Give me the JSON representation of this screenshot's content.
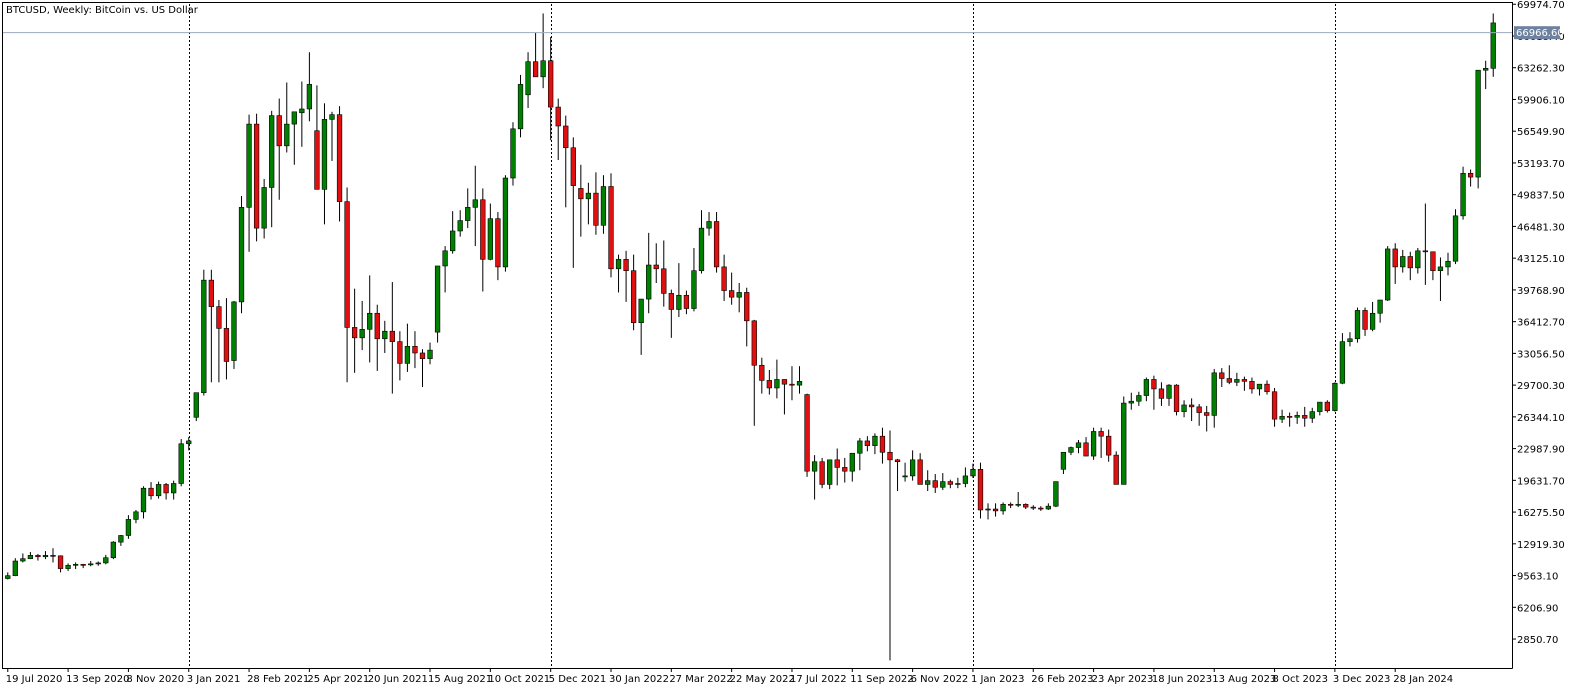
{
  "chart_data": {
    "type": "candlestick",
    "title": "BTCUSD, Weekly:  BitCoin vs. US Dollar",
    "ylim": [
      0,
      70000
    ],
    "y_ticks": [
      "69974.70",
      "66618.40",
      "63262.30",
      "59906.10",
      "56549.90",
      "53193.70",
      "49837.50",
      "46481.30",
      "43125.10",
      "39768.90",
      "36412.70",
      "33056.50",
      "29700.30",
      "26344.10",
      "22987.90",
      "19631.70",
      "16275.50",
      "12919.30",
      "9563.10",
      "6206.90",
      "2850.70"
    ],
    "x_labels": [
      "19 Jul 2020",
      "13 Sep 2020",
      "8 Nov 2020",
      "3 Jan 2021",
      "28 Feb 2021",
      "25 Apr 2021",
      "20 Jun 2021",
      "15 Aug 2021",
      "10 Oct 2021",
      "5 Dec 2021",
      "30 Jan 2022",
      "27 Mar 2022",
      "22 May 2022",
      "17 Jul 2022",
      "11 Sep 2022",
      "6 Nov 2022",
      "1 Jan 2023",
      "26 Feb 2023",
      "23 Apr 2023",
      "18 Jun 2023",
      "13 Aug 2023",
      "8 Oct 2023",
      "3 Dec 2023",
      "28 Jan 2024"
    ],
    "current_price": "66966.60",
    "year_separators": [
      "3 Jan 2021",
      "5 Dec 2021",
      "1 Jan 2023",
      "3 Dec 2023"
    ],
    "colors": {
      "bull": "#008000",
      "bear": "#e01010",
      "wick": "#000000",
      "grid": "#000000",
      "price_line": "#9aaabb",
      "price_tag": "#6e82a0"
    },
    "candles": [
      [
        9250,
        9900,
        9150,
        9550
      ],
      [
        9550,
        11400,
        9500,
        11100
      ],
      [
        11100,
        11900,
        10950,
        11350
      ],
      [
        11350,
        12050,
        11300,
        11700
      ],
      [
        11700,
        11850,
        11150,
        11550
      ],
      [
        11550,
        12150,
        11300,
        11700
      ],
      [
        11700,
        12450,
        10950,
        11650
      ],
      [
        11650,
        11700,
        9900,
        10300
      ],
      [
        10300,
        10850,
        10050,
        10650
      ],
      [
        10650,
        10950,
        10250,
        10750
      ],
      [
        10750,
        10800,
        10350,
        10700
      ],
      [
        10700,
        11100,
        10550,
        10800
      ],
      [
        10800,
        11050,
        10600,
        10900
      ],
      [
        10900,
        11750,
        10750,
        11450
      ],
      [
        11450,
        13200,
        11300,
        13100
      ],
      [
        13100,
        13850,
        12700,
        13800
      ],
      [
        13800,
        15950,
        13450,
        15500
      ],
      [
        15500,
        16500,
        15100,
        16300
      ],
      [
        16300,
        19000,
        15600,
        18800
      ],
      [
        18800,
        19450,
        17600,
        18000
      ],
      [
        18000,
        19500,
        17700,
        19200
      ],
      [
        19200,
        19350,
        17600,
        18300
      ],
      [
        18300,
        19600,
        17600,
        19300
      ],
      [
        19300,
        24000,
        19000,
        23500
      ],
      [
        23500,
        24200,
        22800,
        23800
      ],
      [
        26300,
        28900,
        25900,
        28900
      ],
      [
        28900,
        41900,
        28600,
        40800
      ],
      [
        40800,
        41900,
        30000,
        38000
      ],
      [
        38000,
        38700,
        30000,
        35700
      ],
      [
        35700,
        38900,
        30300,
        32200
      ],
      [
        32300,
        38600,
        31400,
        38500
      ],
      [
        38500,
        49700,
        37300,
        48500
      ],
      [
        48500,
        58300,
        43800,
        57300
      ],
      [
        57300,
        58400,
        44900,
        46300
      ],
      [
        46300,
        51500,
        45200,
        50600
      ],
      [
        50600,
        58700,
        46400,
        58200
      ],
      [
        58200,
        60000,
        49300,
        55000
      ],
      [
        55000,
        61700,
        54300,
        57300
      ],
      [
        57300,
        57500,
        53000,
        58600
      ],
      [
        58500,
        61800,
        54900,
        58900
      ],
      [
        58900,
        64900,
        57600,
        61500
      ],
      [
        56600,
        61400,
        50500,
        50400
      ],
      [
        50400,
        59500,
        46700,
        57800
      ],
      [
        57800,
        58600,
        53400,
        58300
      ],
      [
        58300,
        59200,
        47000,
        49100
      ],
      [
        49100,
        50600,
        30000,
        35800
      ],
      [
        35800,
        39900,
        31000,
        34700
      ],
      [
        34700,
        38600,
        33400,
        35600
      ],
      [
        35600,
        41300,
        32100,
        37300
      ],
      [
        37300,
        38200,
        31200,
        34600
      ],
      [
        34600,
        36500,
        33100,
        35400
      ],
      [
        35400,
        40600,
        28800,
        34300
      ],
      [
        34300,
        35400,
        30200,
        32000
      ],
      [
        32000,
        36200,
        31100,
        33800
      ],
      [
        33800,
        35400,
        31500,
        33100
      ],
      [
        33100,
        33500,
        29500,
        32500
      ],
      [
        32500,
        34200,
        31900,
        33400
      ],
      [
        35300,
        42200,
        34200,
        42300
      ],
      [
        42300,
        44400,
        39500,
        43900
      ],
      [
        43900,
        48100,
        43600,
        46000
      ],
      [
        46000,
        48200,
        45400,
        47100
      ],
      [
        47100,
        50500,
        46300,
        48500
      ],
      [
        48500,
        52900,
        44400,
        49300
      ],
      [
        49300,
        50500,
        39600,
        43000
      ],
      [
        43000,
        48900,
        42900,
        47300
      ],
      [
        47300,
        48000,
        40800,
        42200
      ],
      [
        42200,
        51900,
        41700,
        51600
      ],
      [
        51600,
        57500,
        50800,
        56800
      ],
      [
        56800,
        62500,
        55900,
        61500
      ],
      [
        60400,
        64900,
        59000,
        63900
      ],
      [
        63900,
        67000,
        62500,
        62300
      ],
      [
        62300,
        69000,
        61100,
        64000
      ],
      [
        64000,
        66500,
        55600,
        59100
      ],
      [
        59100,
        60000,
        53500,
        57100
      ],
      [
        57100,
        58200,
        48500,
        54800
      ],
      [
        54800,
        55900,
        42100,
        50800
      ],
      [
        50500,
        53000,
        45400,
        49400
      ],
      [
        49400,
        51100,
        46700,
        50000
      ],
      [
        50000,
        52200,
        45600,
        46600
      ],
      [
        46600,
        51900,
        45700,
        50700
      ],
      [
        50700,
        52100,
        41100,
        42000
      ],
      [
        42000,
        43500,
        39500,
        43000
      ],
      [
        43000,
        43900,
        38500,
        41800
      ],
      [
        41800,
        43500,
        35500,
        36300
      ],
      [
        36300,
        38500,
        32900,
        38800
      ],
      [
        38800,
        45800,
        37300,
        42400
      ],
      [
        42400,
        44700,
        40500,
        42000
      ],
      [
        42000,
        45000,
        38000,
        39400
      ],
      [
        39400,
        39800,
        34700,
        37700
      ],
      [
        37700,
        42600,
        36900,
        39200
      ],
      [
        39200,
        39700,
        37200,
        37800
      ],
      [
        37800,
        44200,
        37500,
        41800
      ],
      [
        41800,
        48200,
        41500,
        46300
      ],
      [
        46300,
        48000,
        45500,
        47000
      ],
      [
        47000,
        48000,
        41600,
        42200
      ],
      [
        42200,
        43500,
        38600,
        39700
      ],
      [
        39700,
        41600,
        38200,
        39000
      ],
      [
        39000,
        40500,
        37400,
        39500
      ],
      [
        39500,
        40000,
        33800,
        36500
      ],
      [
        36500,
        36600,
        25400,
        31800
      ],
      [
        31800,
        32600,
        28800,
        30200
      ],
      [
        30200,
        31300,
        28700,
        29400
      ],
      [
        29400,
        32400,
        28300,
        30300
      ],
      [
        30300,
        30300,
        26600,
        29800
      ],
      [
        29800,
        31700,
        28100,
        29700
      ],
      [
        29700,
        31700,
        28800,
        30100
      ],
      [
        28700,
        28800,
        20000,
        20600
      ],
      [
        20600,
        22300,
        17600,
        21600
      ],
      [
        21600,
        22000,
        18800,
        19200
      ],
      [
        19200,
        21500,
        18700,
        21800
      ],
      [
        21800,
        23000,
        19100,
        21000
      ],
      [
        21000,
        22000,
        19400,
        20600
      ],
      [
        20600,
        22500,
        19500,
        22500
      ],
      [
        22500,
        24100,
        20700,
        23800
      ],
      [
        23800,
        24300,
        22700,
        23300
      ],
      [
        23300,
        24600,
        22400,
        24300
      ],
      [
        24300,
        25200,
        21400,
        22600
      ],
      [
        22600,
        24900,
        600,
        21800
      ],
      [
        21800,
        21900,
        18500,
        21600
      ],
      [
        20000,
        21500,
        19500,
        20100
      ],
      [
        20100,
        22800,
        19600,
        21800
      ],
      [
        21800,
        22500,
        19800,
        19200
      ],
      [
        19200,
        20700,
        18500,
        19600
      ],
      [
        19600,
        20300,
        18300,
        18900
      ],
      [
        18900,
        20400,
        18600,
        19500
      ],
      [
        19500,
        19700,
        18800,
        19200
      ],
      [
        19200,
        19900,
        18800,
        19300
      ],
      [
        19300,
        21000,
        18900,
        20100
      ],
      [
        20100,
        21400,
        19900,
        20800
      ],
      [
        20800,
        21500,
        15600,
        16500
      ],
      [
        16500,
        17200,
        15500,
        16600
      ],
      [
        16600,
        17200,
        15800,
        16400
      ],
      [
        16400,
        17300,
        16000,
        17100
      ],
      [
        17100,
        17300,
        16700,
        17000
      ],
      [
        17000,
        18400,
        16800,
        17100
      ],
      [
        17100,
        17200,
        16600,
        16800
      ],
      [
        16800,
        17000,
        16500,
        16700
      ],
      [
        16700,
        16900,
        16400,
        16600
      ],
      [
        16600,
        17200,
        16500,
        16900
      ],
      [
        16900,
        19200,
        16800,
        19500
      ],
      [
        20800,
        21300,
        20300,
        22600
      ],
      [
        22600,
        23200,
        22300,
        23100
      ],
      [
        23100,
        23900,
        22500,
        23600
      ],
      [
        23600,
        24200,
        22700,
        22200
      ],
      [
        22200,
        25200,
        21800,
        24800
      ],
      [
        24800,
        25200,
        22000,
        24300
      ],
      [
        24300,
        25000,
        21600,
        22300
      ],
      [
        22300,
        22700,
        19600,
        19200
      ],
      [
        19200,
        28500,
        19500,
        27800
      ],
      [
        27800,
        28900,
        27100,
        28000
      ],
      [
        28000,
        29000,
        27500,
        28600
      ],
      [
        28600,
        30500,
        28000,
        30300
      ],
      [
        30300,
        30700,
        27100,
        29300
      ],
      [
        29300,
        30000,
        27500,
        28300
      ],
      [
        28300,
        29800,
        27500,
        29700
      ],
      [
        29700,
        29800,
        26500,
        26900
      ],
      [
        26900,
        28100,
        26300,
        27600
      ],
      [
        27600,
        28300,
        25900,
        27400
      ],
      [
        27400,
        27700,
        25400,
        26800
      ],
      [
        26800,
        27500,
        24800,
        26500
      ],
      [
        26500,
        31400,
        25200,
        31000
      ],
      [
        31000,
        31500,
        29500,
        30400
      ],
      [
        30400,
        31800,
        29800,
        30000
      ],
      [
        30000,
        31000,
        29600,
        30300
      ],
      [
        30300,
        30600,
        29100,
        30100
      ],
      [
        30100,
        30500,
        28800,
        29300
      ],
      [
        29300,
        29700,
        28600,
        29800
      ],
      [
        29800,
        30200,
        28700,
        29000
      ],
      [
        29000,
        29400,
        25300,
        26100
      ],
      [
        26100,
        27100,
        25700,
        26400
      ],
      [
        26400,
        26800,
        25300,
        26300
      ],
      [
        26300,
        26900,
        25600,
        26500
      ],
      [
        26500,
        27400,
        25300,
        26200
      ],
      [
        26200,
        27300,
        25700,
        26900
      ],
      [
        26900,
        27700,
        26500,
        27900
      ],
      [
        27900,
        28100,
        26800,
        27000
      ],
      [
        27000,
        30000,
        26900,
        29900
      ],
      [
        29900,
        35200,
        29800,
        34300
      ],
      [
        34300,
        35300,
        33800,
        34600
      ],
      [
        34600,
        37900,
        34200,
        37600
      ],
      [
        37600,
        37900,
        34900,
        35600
      ],
      [
        35600,
        38500,
        35400,
        37300
      ],
      [
        37300,
        38500,
        36300,
        38700
      ],
      [
        38700,
        44400,
        38600,
        44100
      ],
      [
        44100,
        44700,
        40400,
        42200
      ],
      [
        42200,
        44000,
        41600,
        43300
      ],
      [
        43300,
        43800,
        40800,
        42100
      ],
      [
        42100,
        44200,
        41500,
        43900
      ],
      [
        43900,
        48900,
        40300,
        43800
      ],
      [
        43800,
        43000,
        40800,
        41800
      ],
      [
        41800,
        43200,
        38600,
        42200
      ],
      [
        42200,
        43700,
        41300,
        42800
      ],
      [
        42800,
        48300,
        42500,
        47600
      ],
      [
        47600,
        52800,
        47200,
        52100
      ],
      [
        52100,
        52500,
        50700,
        51700
      ],
      [
        51700,
        53400,
        50500,
        63000
      ],
      [
        63000,
        64000,
        61000,
        63200
      ],
      [
        63200,
        69000,
        62300,
        68000
      ]
    ]
  }
}
